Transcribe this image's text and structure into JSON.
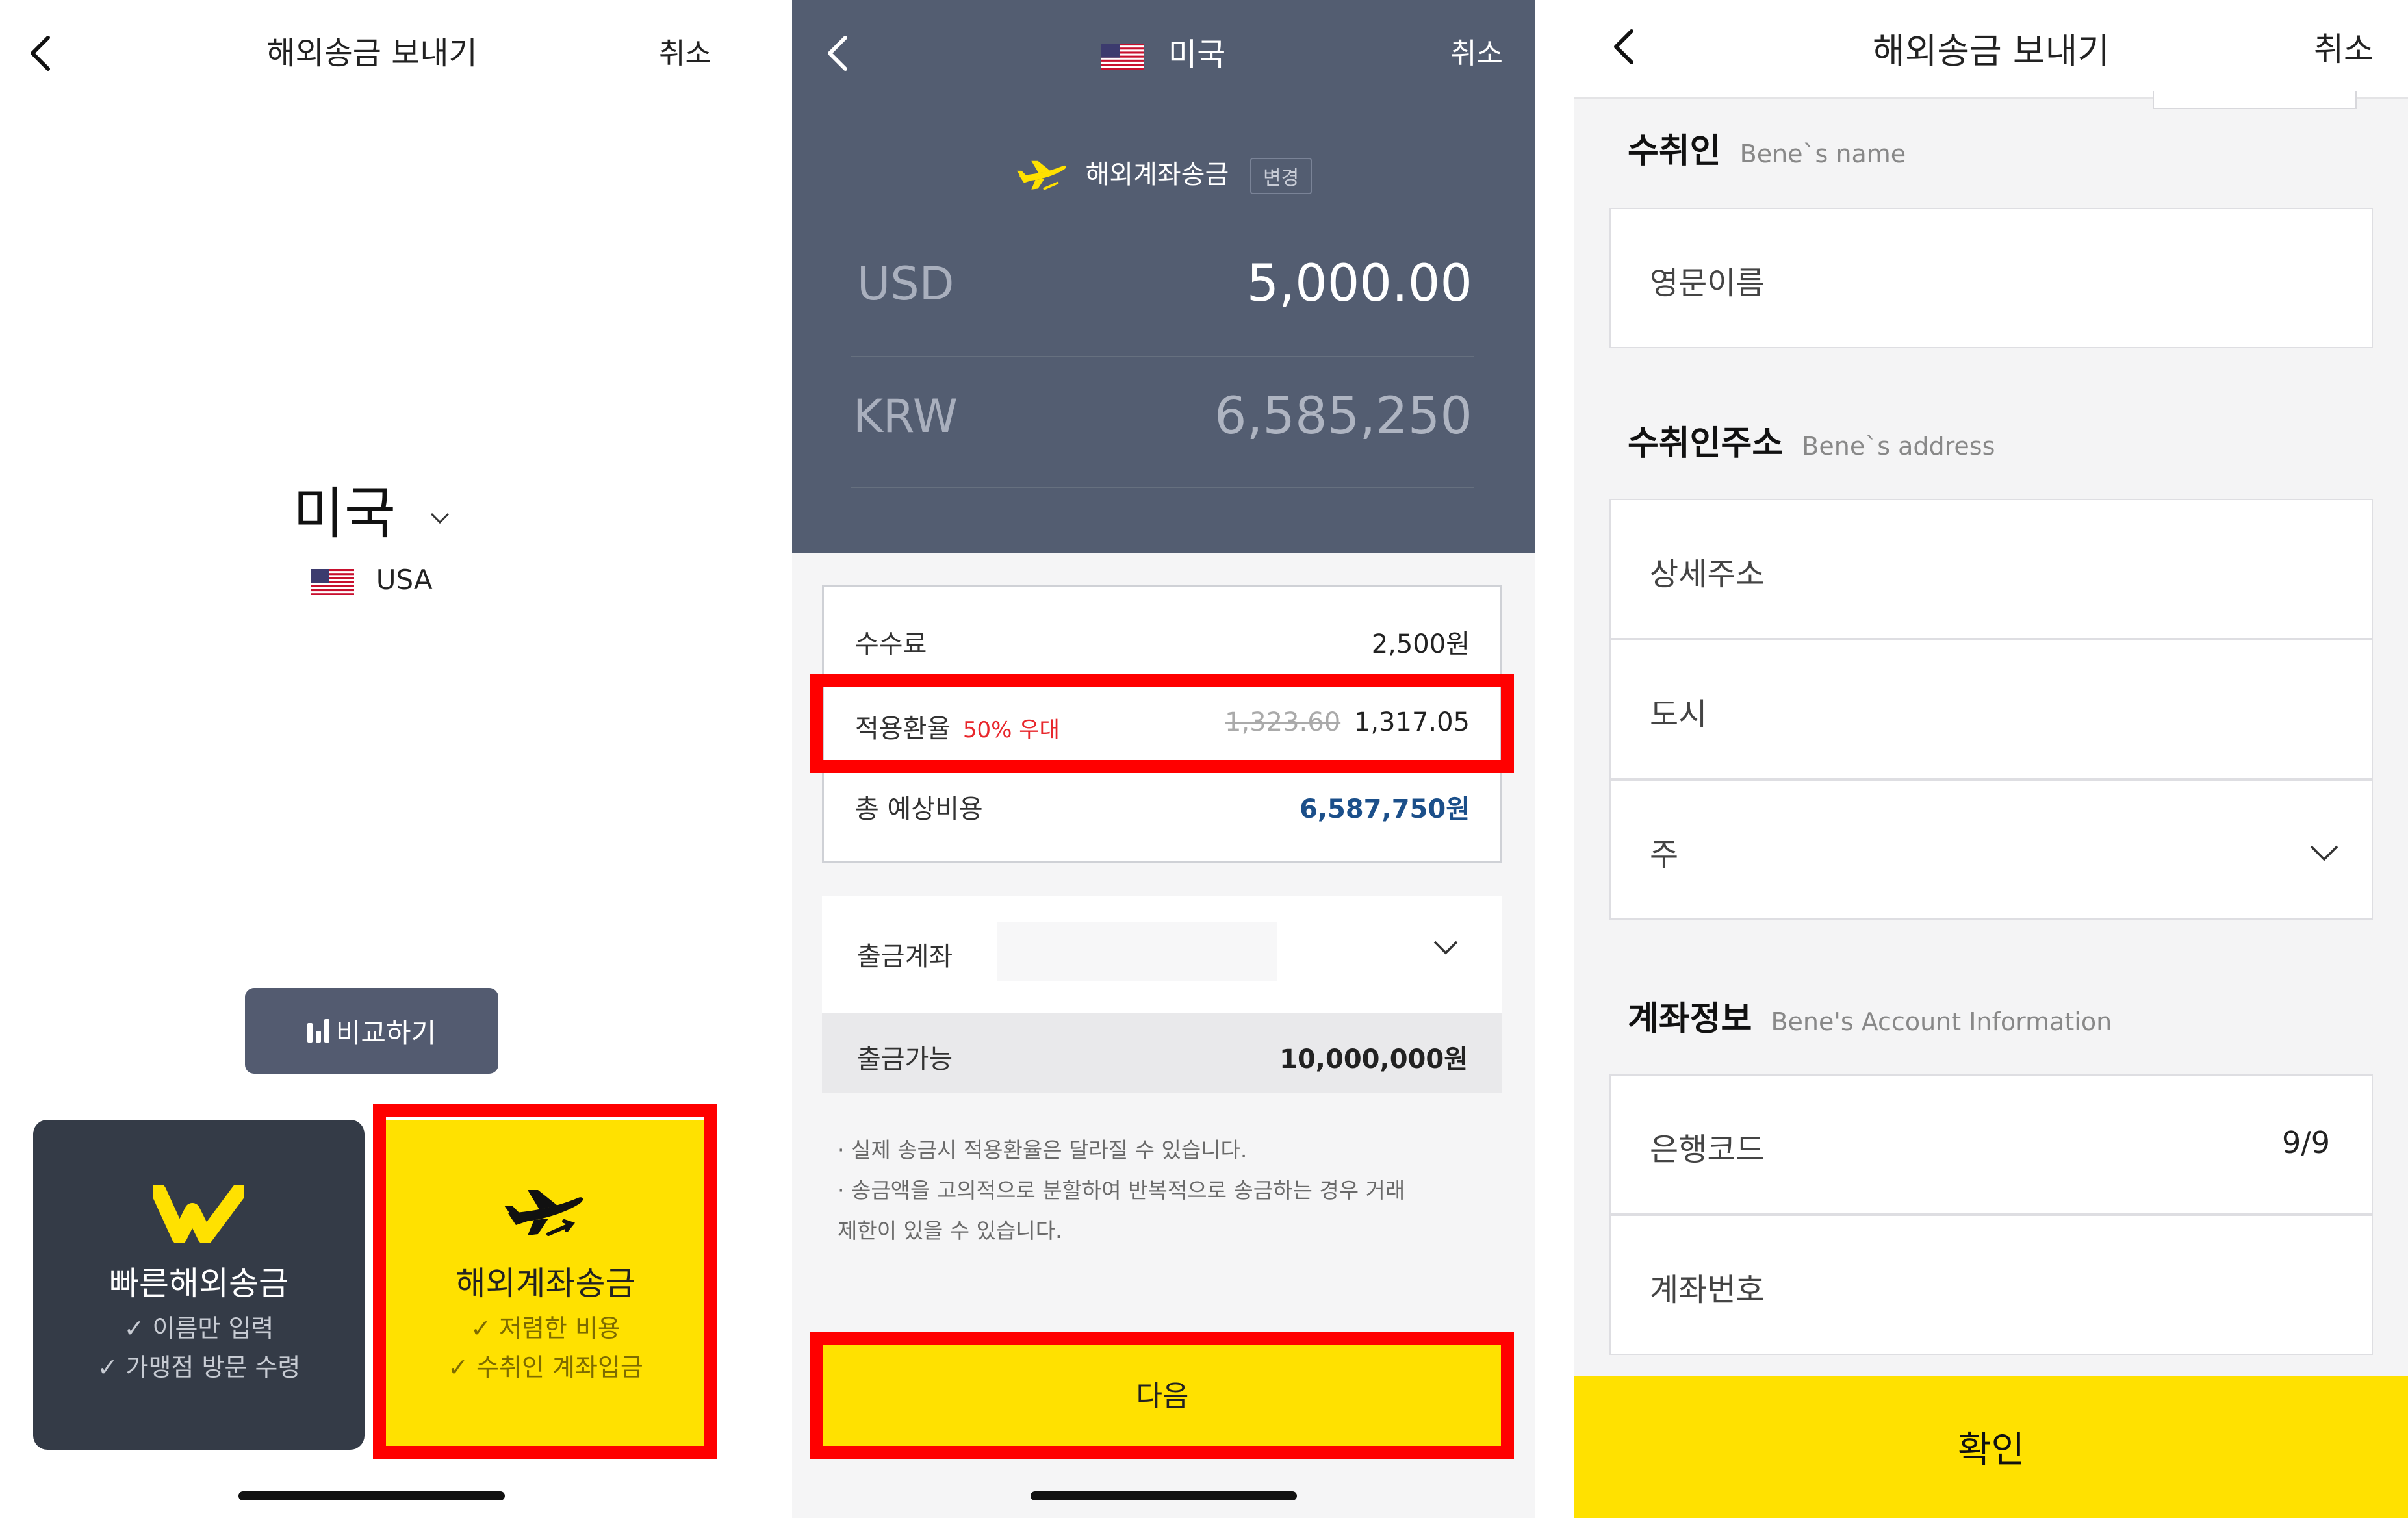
{
  "panel1": {
    "title": "해외송금 보내기",
    "cancel": "취소",
    "country": "미국",
    "country_code": "USA",
    "compare_button": "비교하기",
    "card_fast": {
      "title": "빠른해외송금",
      "feature1": "✓ 이름만 입력",
      "feature2": "✓ 가맹점 방문 수령"
    },
    "card_account": {
      "title": "해외계좌송금",
      "feature1": "✓ 저렴한 비용",
      "feature2": "✓ 수취인 계좌입금"
    }
  },
  "panel2": {
    "country": "미국",
    "cancel": "취소",
    "method": "해외계좌송금",
    "change": "변경",
    "send_currency": "USD",
    "send_amount": "5,000.00",
    "receive_currency": "KRW",
    "receive_amount": "6,585,250",
    "fee_label": "수수료",
    "fee_value": "2,500원",
    "rate_label": "적용환율",
    "rate_discount": "50% 우대",
    "rate_original": "1,323.60",
    "rate_value": "1,317.05",
    "total_label": "총 예상비용",
    "total_value": "6,587,750원",
    "account_label": "출금계좌",
    "available_label": "출금가능",
    "available_value": "10,000,000원",
    "note1": "· 실제 송금시 적용환율은 달라질 수 있습니다.",
    "note2": "· 송금액을 고의적으로 분할하여 반복적으로 송금하는 경우 거래",
    "note3": "제한이 있을 수 있습니다.",
    "next_button": "다음"
  },
  "panel3": {
    "title": "해외송금 보내기",
    "cancel": "취소",
    "beneficiary_title": "수취인",
    "beneficiary_sub": "Bene`s name",
    "name_placeholder": "영문이름",
    "address_title": "수취인주소",
    "address_sub": "Bene`s address",
    "detail_address": "상세주소",
    "city": "도시",
    "state": "주",
    "account_title": "계좌정보",
    "account_sub": "Bene's Account Information",
    "bank_code": "은행코드",
    "bank_code_count": "9/9",
    "account_number": "계좌번호",
    "confirm_button": "확인"
  },
  "colors": {
    "brand_yellow": "#ffe100",
    "header_slate": "#535d71",
    "card_dark": "#343b47",
    "highlight_red": "#ff0000",
    "total_blue": "#1b4f8a",
    "discount_red": "#e8262b"
  }
}
